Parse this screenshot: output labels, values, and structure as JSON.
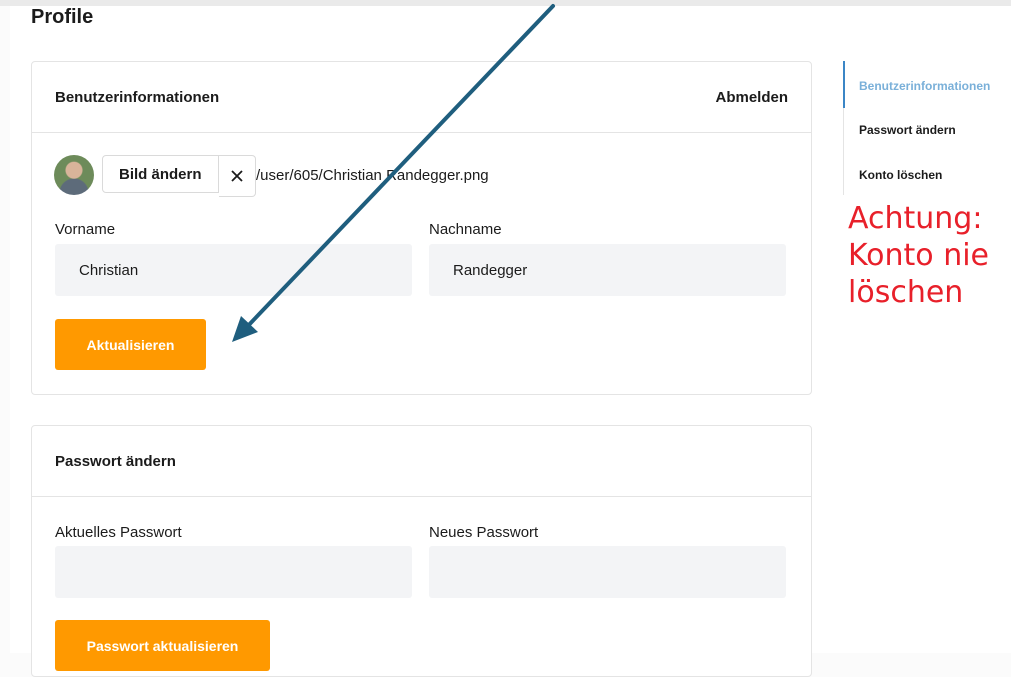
{
  "page": {
    "title": "Profile"
  },
  "user_info": {
    "header": "Benutzerinformationen",
    "logout_label": "Abmelden",
    "change_picture_label": "Bild ändern",
    "file_path": "/user/605/Christian Randegger.png",
    "firstname_label": "Vorname",
    "firstname_value": "Christian",
    "lastname_label": "Nachname",
    "lastname_value": "Randegger",
    "update_label": "Aktualisieren"
  },
  "password": {
    "header": "Passwort ändern",
    "current_label": "Aktuelles Passwort",
    "new_label": "Neues Passwort",
    "update_label": "Passwort aktualisieren"
  },
  "sidenav": {
    "items": [
      {
        "label": "Benutzerinformationen",
        "active": true
      },
      {
        "label": "Passwort ändern",
        "active": false
      },
      {
        "label": "Konto löschen",
        "active": false
      }
    ]
  },
  "annotation": {
    "warning_lines": [
      "Achtung:",
      "Konto nie",
      "löschen"
    ]
  },
  "colors": {
    "accent": "#ff9900",
    "active_nav": "#7ab0d9",
    "warning": "#e8202a",
    "arrow": "#1f5e7e"
  }
}
